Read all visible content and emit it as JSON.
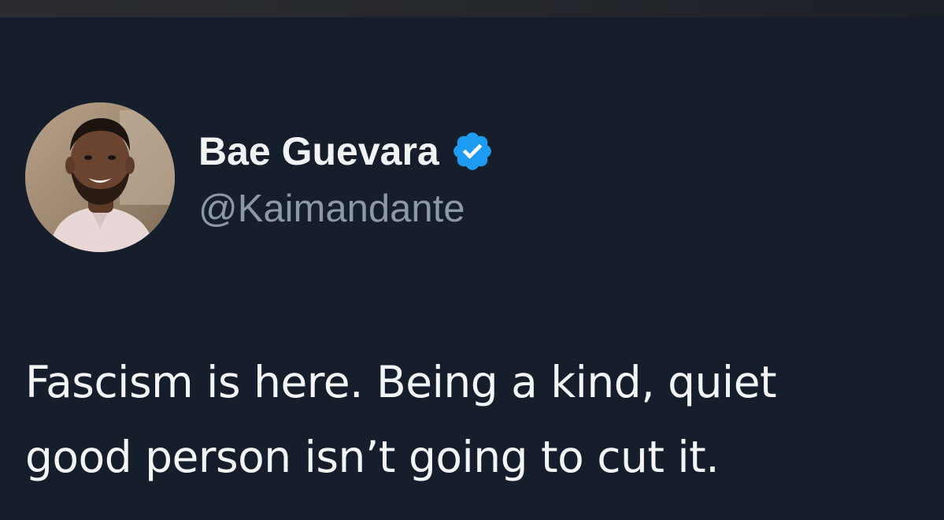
{
  "colors": {
    "background": "#151e2a",
    "name_text": "#f1f3f5",
    "handle_text": "#8d98a5",
    "body_text": "#f4f5f6",
    "verified_badge": "#1d9bf0"
  },
  "author": {
    "display_name": "Bae Guevara",
    "handle": "@Kaimandante",
    "verified_icon": "verified-badge-icon",
    "avatar": "profile-photo"
  },
  "tweet": {
    "lines": [
      "Fascism is here. Being a kind, quiet",
      "good person isn’t going to cut it."
    ]
  }
}
